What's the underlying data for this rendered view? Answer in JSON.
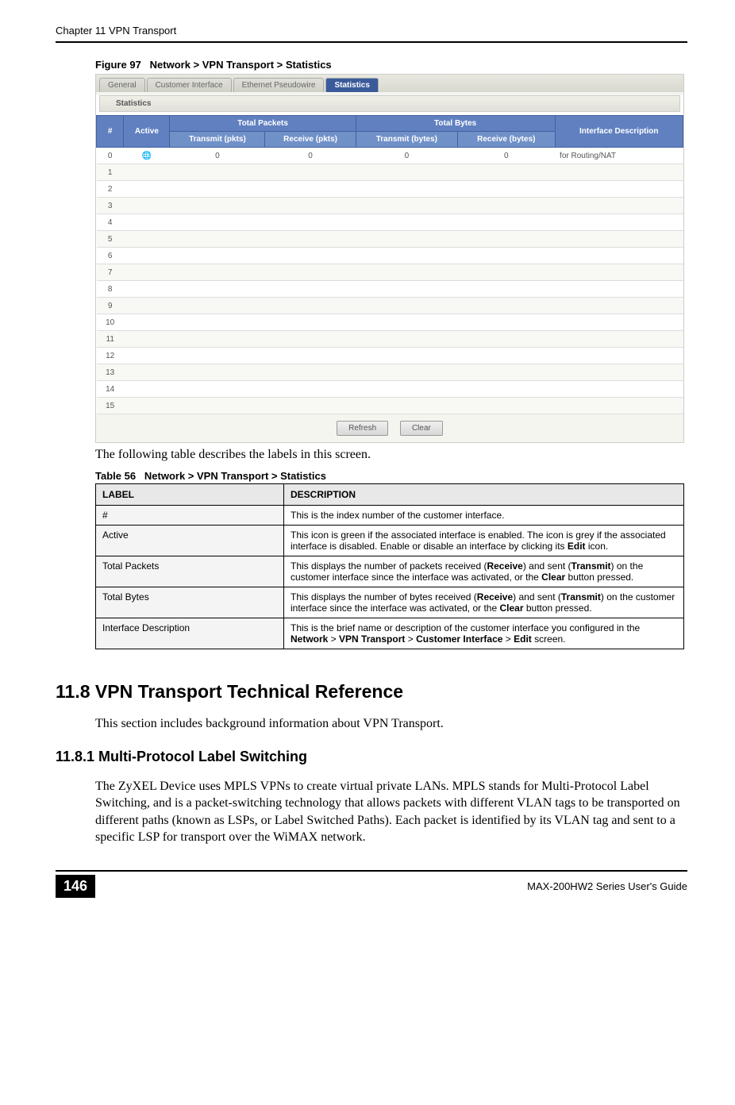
{
  "header": {
    "chapter": "Chapter 11 VPN Transport"
  },
  "figure": {
    "label": "Figure 97",
    "caption": "Network > VPN Transport > Statistics"
  },
  "screenshot": {
    "tabs": [
      "General",
      "Customer Interface",
      "Ethernet Pseudowire",
      "Statistics"
    ],
    "panel_title": "Statistics",
    "headers": {
      "num": "#",
      "active": "Active",
      "total_packets": "Total Packets",
      "total_bytes": "Total Bytes",
      "iface_desc": "Interface Description",
      "tx_pkts": "Transmit (pkts)",
      "rx_pkts": "Receive (pkts)",
      "tx_bytes": "Transmit (bytes)",
      "rx_bytes": "Receive (bytes)"
    },
    "rows": [
      {
        "n": "0",
        "active": "●",
        "txp": "0",
        "rxp": "0",
        "txb": "0",
        "rxb": "0",
        "desc": "for Routing/NAT"
      },
      {
        "n": "1",
        "active": "",
        "txp": "",
        "rxp": "",
        "txb": "",
        "rxb": "",
        "desc": ""
      },
      {
        "n": "2",
        "active": "",
        "txp": "",
        "rxp": "",
        "txb": "",
        "rxb": "",
        "desc": ""
      },
      {
        "n": "3",
        "active": "",
        "txp": "",
        "rxp": "",
        "txb": "",
        "rxb": "",
        "desc": ""
      },
      {
        "n": "4",
        "active": "",
        "txp": "",
        "rxp": "",
        "txb": "",
        "rxb": "",
        "desc": ""
      },
      {
        "n": "5",
        "active": "",
        "txp": "",
        "rxp": "",
        "txb": "",
        "rxb": "",
        "desc": ""
      },
      {
        "n": "6",
        "active": "",
        "txp": "",
        "rxp": "",
        "txb": "",
        "rxb": "",
        "desc": ""
      },
      {
        "n": "7",
        "active": "",
        "txp": "",
        "rxp": "",
        "txb": "",
        "rxb": "",
        "desc": ""
      },
      {
        "n": "8",
        "active": "",
        "txp": "",
        "rxp": "",
        "txb": "",
        "rxb": "",
        "desc": ""
      },
      {
        "n": "9",
        "active": "",
        "txp": "",
        "rxp": "",
        "txb": "",
        "rxb": "",
        "desc": ""
      },
      {
        "n": "10",
        "active": "",
        "txp": "",
        "rxp": "",
        "txb": "",
        "rxb": "",
        "desc": ""
      },
      {
        "n": "11",
        "active": "",
        "txp": "",
        "rxp": "",
        "txb": "",
        "rxb": "",
        "desc": ""
      },
      {
        "n": "12",
        "active": "",
        "txp": "",
        "rxp": "",
        "txb": "",
        "rxb": "",
        "desc": ""
      },
      {
        "n": "13",
        "active": "",
        "txp": "",
        "rxp": "",
        "txb": "",
        "rxb": "",
        "desc": ""
      },
      {
        "n": "14",
        "active": "",
        "txp": "",
        "rxp": "",
        "txb": "",
        "rxb": "",
        "desc": ""
      },
      {
        "n": "15",
        "active": "",
        "txp": "",
        "rxp": "",
        "txb": "",
        "rxb": "",
        "desc": ""
      }
    ],
    "buttons": {
      "refresh": "Refresh",
      "clear": "Clear"
    }
  },
  "intro_text": "The following table describes the labels in this screen.",
  "table56": {
    "label": "Table 56",
    "caption": "Network > VPN Transport > Statistics",
    "head_label": "LABEL",
    "head_desc": "DESCRIPTION",
    "rows": [
      {
        "label": "#",
        "desc_html": "This is the index number of the customer interface."
      },
      {
        "label": "Active",
        "desc_html": "This icon is green if the associated interface is enabled. The icon is grey if the associated interface is disabled. Enable or disable an interface by clicking its <b>Edit</b> icon."
      },
      {
        "label": "Total Packets",
        "desc_html": "This displays the number of packets received (<b>Receive</b>) and sent (<b>Transmit</b>) on the customer interface since the interface was activated, or the <b>Clear</b> button pressed."
      },
      {
        "label": "Total Bytes",
        "desc_html": "This displays the number of bytes received (<b>Receive</b>) and sent (<b>Transmit</b>) on the customer interface since the interface was activated, or the <b>Clear</b> button pressed."
      },
      {
        "label": "Interface Description",
        "desc_html": "This is the brief name or description of the customer interface you configured in the <b>Network</b> > <b>VPN Transport</b> > <b>Customer Interface</b> > <b>Edit</b> screen."
      }
    ]
  },
  "section_11_8": {
    "heading": "11.8  VPN Transport Technical Reference",
    "text": "This section includes background information about VPN Transport."
  },
  "section_11_8_1": {
    "heading": "11.8.1  Multi-Protocol Label Switching",
    "text": "The ZyXEL Device uses MPLS VPNs to create virtual private LANs. MPLS stands for Multi-Protocol Label Switching, and is a packet-switching technology that allows packets with different VLAN tags to be transported on different paths (known as LSPs, or Label Switched Paths). Each packet is identified by its VLAN tag and sent to a specific LSP for transport over the WiMAX network."
  },
  "footer": {
    "page": "146",
    "guide": "MAX-200HW2 Series User's Guide"
  }
}
